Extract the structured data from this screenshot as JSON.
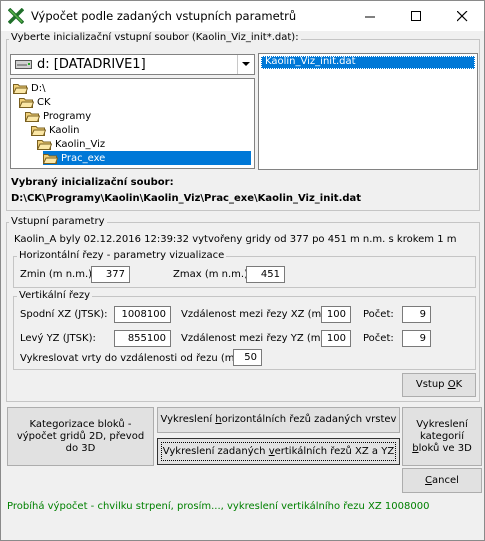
{
  "window": {
    "title": "Výpočet podle zadaných vstupních parametrů"
  },
  "init_group": {
    "label": "Vyberte inicializační vstupní soubor (Kaolin_Viz_init*.dat):",
    "drive": "d: [DATADRIVE1]",
    "folders": [
      {
        "name": "D:\\",
        "depth": 0
      },
      {
        "name": "CK",
        "depth": 1
      },
      {
        "name": "Programy",
        "depth": 2
      },
      {
        "name": "Kaolin",
        "depth": 3
      },
      {
        "name": "Kaolin_Viz",
        "depth": 4
      },
      {
        "name": "Prac_exe",
        "depth": 5
      }
    ],
    "file": "Kaolin_Viz_init.dat",
    "selected_label": "Vybraný inicializační soubor:",
    "selected_path": "D:\\CK\\Programy\\Kaolin\\Kaolin_Viz\\Prac_exe\\Kaolin_Viz_init.dat"
  },
  "params": {
    "label": "Vstupní parametry",
    "info": "Kaolin_A byly 02.12.2016 12:39:32 vytvořeny gridy od 377 po 451 m n.m. s krokem 1 m",
    "horiz": {
      "label": "Horizontální řezy - parametry vizualizace",
      "zmin_label": "Zmin (m n.m.):",
      "zmin": "377",
      "zmax_label": "Zmax (m n.m.):",
      "zmax": "451"
    },
    "vert": {
      "label": "Vertikální řezy",
      "xz_label": "Spodní XZ (JTSK):",
      "xz": "1008100",
      "dist_xz_label": "Vzdálenost mezi řezy XZ (m):",
      "dist_xz": "100",
      "count_label": "Počet:",
      "count_xz": "9",
      "yz_label": "Levý YZ (JTSK):",
      "yz": "855100",
      "dist_yz_label": "Vzdálenost mezi řezy YZ (m):",
      "dist_yz": "100",
      "count_yz": "9",
      "wells_label": "Vykreslovat vrty do vzdálenosti od řezu (m):",
      "wells": "50"
    },
    "ok_pre": "Vstup ",
    "ok_acc": "O",
    "ok_post": "K"
  },
  "buttons": {
    "categorize": "Kategorizace bloků - výpočet gridů 2D, převod do 3D",
    "horiz_pre": "Vykreslení ",
    "horiz_acc": "h",
    "horiz_post": "orizontálních řezů zadaných vrstev",
    "vert_pre": "Vykreslení zadaných ",
    "vert_acc": "v",
    "vert_post": "ertikálních řezů XZ a YZ",
    "cat3d_pre": "Vykreslení kategorií ",
    "cat3d_acc": "b",
    "cat3d_post": "loků ve 3D",
    "cancel_acc": "C",
    "cancel_post": "ancel"
  },
  "status": "Probíhá výpočet - chvilku strpení, prosím..., vykreslení vertikálního řezu XZ 1008000",
  "colors": {
    "selection": "#0078d7",
    "status": "#008000",
    "folder": "#f0d07a"
  }
}
